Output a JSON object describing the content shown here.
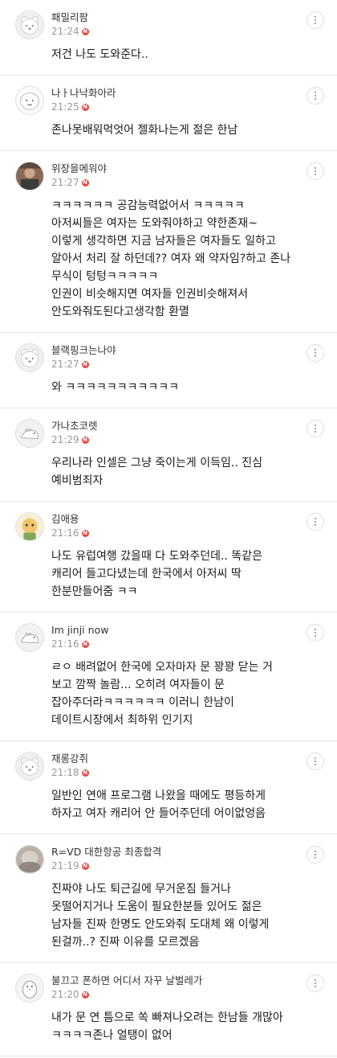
{
  "comments": [
    {
      "nickname": "패밀리팜",
      "time": "21:24",
      "badge": "N",
      "avatar": "bear-default-avatar",
      "text": "저건 나도 도와준다.."
    },
    {
      "nickname": "나ㅏ나낙화아라",
      "time": "21:25",
      "badge": "N",
      "avatar": "bear-drawn-avatar",
      "text": "존나못배워먹엇어 젤화나는게 젊은 한남"
    },
    {
      "nickname": "위장을메워야",
      "time": "21:27",
      "badge": "N",
      "avatar": "photo-avatar",
      "text": "ㅋㅋㅋㅋㅋㅋ 공감능력없어서 ㅋㅋㅋㅋㅋ\n아저씨들은 여자는 도와줘야하고 약한존재~\n이렇게 생각하면 지금 남자들은 여자들도 일하고\n알아서 처리 잘 하던데?? 여자 왜 약자임?하고 존나\n무식이 텅텅ㅋㅋㅋㅋㅋ\n인권이 비슷해지면 여자들 인권비슷해져서\n안도와줘도된다고생각함 환멸"
    },
    {
      "nickname": "블랙핑크는나야",
      "time": "21:27",
      "badge": "N",
      "avatar": "bear-default-avatar",
      "text": "와 ㅋㅋㅋㅋㅋㅋㅋㅋㅋㅋㅋ"
    },
    {
      "nickname": "가나초코렛",
      "time": "21:29",
      "badge": "N",
      "avatar": "dino-avatar",
      "text": "우리나라 인셀은 그냥 죽이는게 이득임.. 진심\n예비범죄자"
    },
    {
      "nickname": "김애용",
      "time": "21:16",
      "badge": "N",
      "avatar": "character-avatar",
      "text": "나도 유럽여행 갔을때 다 도와주던데.. 똑같은\n캐리어 들고다녔는데 한국에서 아저씨 딱\n한분만들어줌 ㅋㅋ"
    },
    {
      "nickname": "Im jinji now",
      "time": "21:16",
      "badge": "N",
      "avatar": "dino-avatar",
      "text": "ㄹㅇ 배려없어 한국에 오자마자 문 꽝꽝 닫는 거\n보고 깜짝 놀람... 오히려 여자들이 문\n잡아주더라ㅋㅋㅋㅋㅋㅋ 이러니 한남이\n데이트시장에서 최하위 인기지"
    },
    {
      "nickname": "재롱강쥐",
      "time": "21:18",
      "badge": "N",
      "avatar": "bear-default-avatar",
      "text": "일반인 연애 프로그램 나왔을 때에도 평등하게\n하자고 여자 캐리어 안 들어주던데 어이없엉음"
    },
    {
      "nickname": "R=VD 대한항공 최종합격",
      "time": "21:19",
      "badge": "N",
      "avatar": "blur-photo-avatar",
      "text": "진짜야 나도 퇴근길에 무거운짐 들거나\n옷떨어지거나 도움이 필요한분들 있어도 젊은\n남자들 진짜 한명도 안도와줘 도대체 왜 이렇게\n된걸까..? 진짜 이유를 모르겠음"
    },
    {
      "nickname": "불끄고 폰하면 어디서 자꾸 날벌레가",
      "time": "21:20",
      "badge": "N",
      "avatar": "penguin-avatar",
      "text": "내가 문 연 틈으로 쏙 빠져나오려는 한남들 개많아\nㅋㅋㅋㅋ존나 얼탱이 없어"
    }
  ]
}
